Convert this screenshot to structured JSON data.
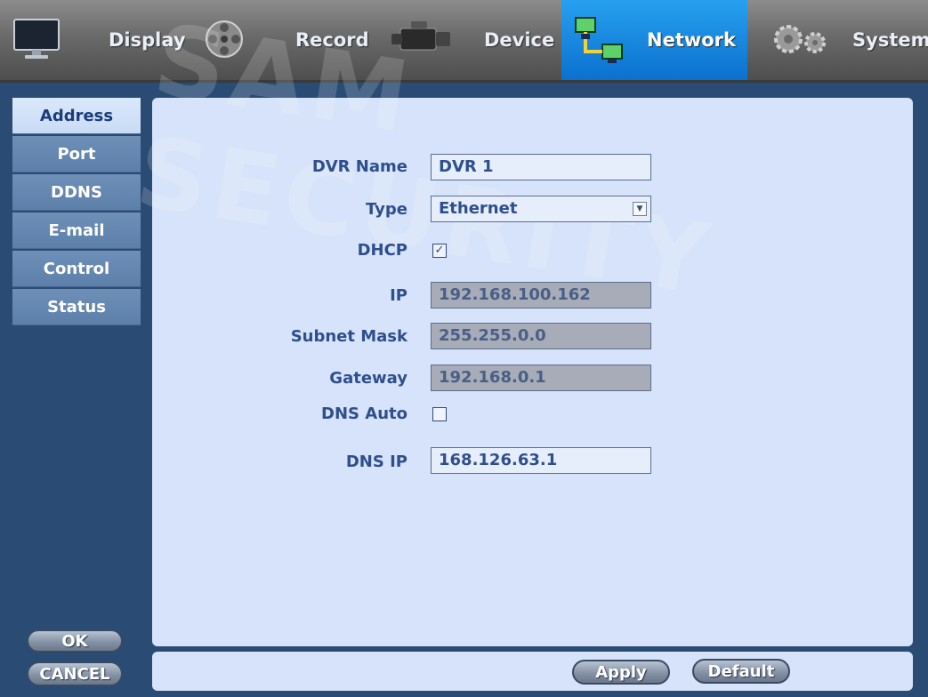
{
  "tabs": [
    {
      "label": "Display",
      "icon": "monitor-icon",
      "active": false
    },
    {
      "label": "Record",
      "icon": "film-reel-icon",
      "active": false
    },
    {
      "label": "Device",
      "icon": "camera-icon",
      "active": false
    },
    {
      "label": "Network",
      "icon": "network-icon",
      "active": true
    },
    {
      "label": "System",
      "icon": "gears-icon",
      "active": false
    }
  ],
  "side_menu": [
    {
      "label": "Address",
      "active": true
    },
    {
      "label": "Port"
    },
    {
      "label": "DDNS"
    },
    {
      "label": "E-mail"
    },
    {
      "label": "Control"
    },
    {
      "label": "Status"
    }
  ],
  "form": {
    "dvr_name": {
      "label": "DVR Name",
      "value": "DVR 1"
    },
    "type": {
      "label": "Type",
      "value": "Ethernet"
    },
    "dhcp": {
      "label": "DHCP",
      "checked": true,
      "glyph": "☑"
    },
    "ip": {
      "label": "IP",
      "value": "192.168.100.162"
    },
    "subnet": {
      "label": "Subnet Mask",
      "value": "255.255.0.0"
    },
    "gateway": {
      "label": "Gateway",
      "value": "192.168.0.1"
    },
    "dns_auto": {
      "label": "DNS Auto",
      "checked": false
    },
    "dns_ip": {
      "label": "DNS IP",
      "value": "168.126.63.1"
    }
  },
  "buttons": {
    "ok": "OK",
    "cancel": "CANCEL",
    "apply": "Apply",
    "default": "Default"
  },
  "watermark": "SAM SECURITY",
  "colors": {
    "active_tab": "#0b71cf",
    "panel_bg": "#d6e3fa",
    "label_text": "#2e4f8c"
  }
}
